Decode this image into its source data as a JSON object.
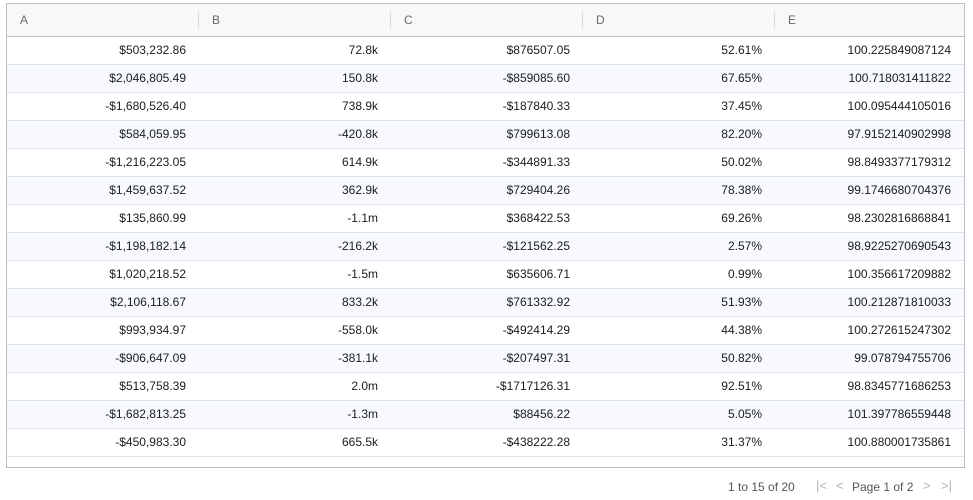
{
  "columns": [
    "A",
    "B",
    "C",
    "D",
    "E"
  ],
  "rows": [
    [
      "$503,232.86",
      "72.8k",
      "$876507.05",
      "52.61%",
      "100.225849087124"
    ],
    [
      "$2,046,805.49",
      "150.8k",
      "-$859085.60",
      "67.65%",
      "100.718031411822"
    ],
    [
      "-$1,680,526.40",
      "738.9k",
      "-$187840.33",
      "37.45%",
      "100.095444105016"
    ],
    [
      "$584,059.95",
      "-420.8k",
      "$799613.08",
      "82.20%",
      "97.9152140902998"
    ],
    [
      "-$1,216,223.05",
      "614.9k",
      "-$344891.33",
      "50.02%",
      "98.8493377179312"
    ],
    [
      "$1,459,637.52",
      "362.9k",
      "$729404.26",
      "78.38%",
      "99.1746680704376"
    ],
    [
      "$135,860.99",
      "-1.1m",
      "$368422.53",
      "69.26%",
      "98.2302816868841"
    ],
    [
      "-$1,198,182.14",
      "-216.2k",
      "-$121562.25",
      "2.57%",
      "98.9225270690543"
    ],
    [
      "$1,020,218.52",
      "-1.5m",
      "$635606.71",
      "0.99%",
      "100.356617209882"
    ],
    [
      "$2,106,118.67",
      "833.2k",
      "$761332.92",
      "51.93%",
      "100.212871810033"
    ],
    [
      "$993,934.97",
      "-558.0k",
      "-$492414.29",
      "44.38%",
      "100.272615247302"
    ],
    [
      "-$906,647.09",
      "-381.1k",
      "-$207497.31",
      "50.82%",
      "99.078794755706"
    ],
    [
      "$513,758.39",
      "2.0m",
      "-$1717126.31",
      "92.51%",
      "98.8345771686253"
    ],
    [
      "-$1,682,813.25",
      "-1.3m",
      "$88456.22",
      "5.05%",
      "101.397786559448"
    ],
    [
      "-$450,983.30",
      "665.5k",
      "-$438222.28",
      "31.37%",
      "100.880001735861"
    ]
  ],
  "pagination": {
    "summary": "1 to 15 of 20",
    "page_label": "Page 1 of 2",
    "first_icon": "first-page-icon",
    "prev_icon": "previous-page-icon",
    "next_icon": "next-page-icon",
    "last_icon": "last-page-icon"
  }
}
